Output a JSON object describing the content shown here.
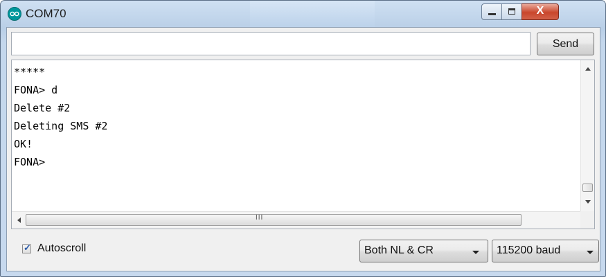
{
  "window": {
    "title": "COM70",
    "close_glyph": "X",
    "icons": [
      "arduino-logo-icon",
      "minimize-icon",
      "maximize-icon",
      "close-icon"
    ]
  },
  "send": {
    "input_value": "",
    "button_label": "Send"
  },
  "output": {
    "lines": [
      "*****",
      "FONA> d",
      "Delete #2",
      "Deleting SMS #2",
      "OK!",
      "FONA>"
    ],
    "hscroll_grip": "III"
  },
  "footer": {
    "autoscroll_label": "Autoscroll",
    "autoscroll_checked": true,
    "line_ending_selected": "Both NL & CR",
    "baud_selected": "115200 baud"
  },
  "colors": {
    "titlebar": "#c4d7ec",
    "close_button": "#c9462c",
    "arduino_teal": "#00979c"
  }
}
